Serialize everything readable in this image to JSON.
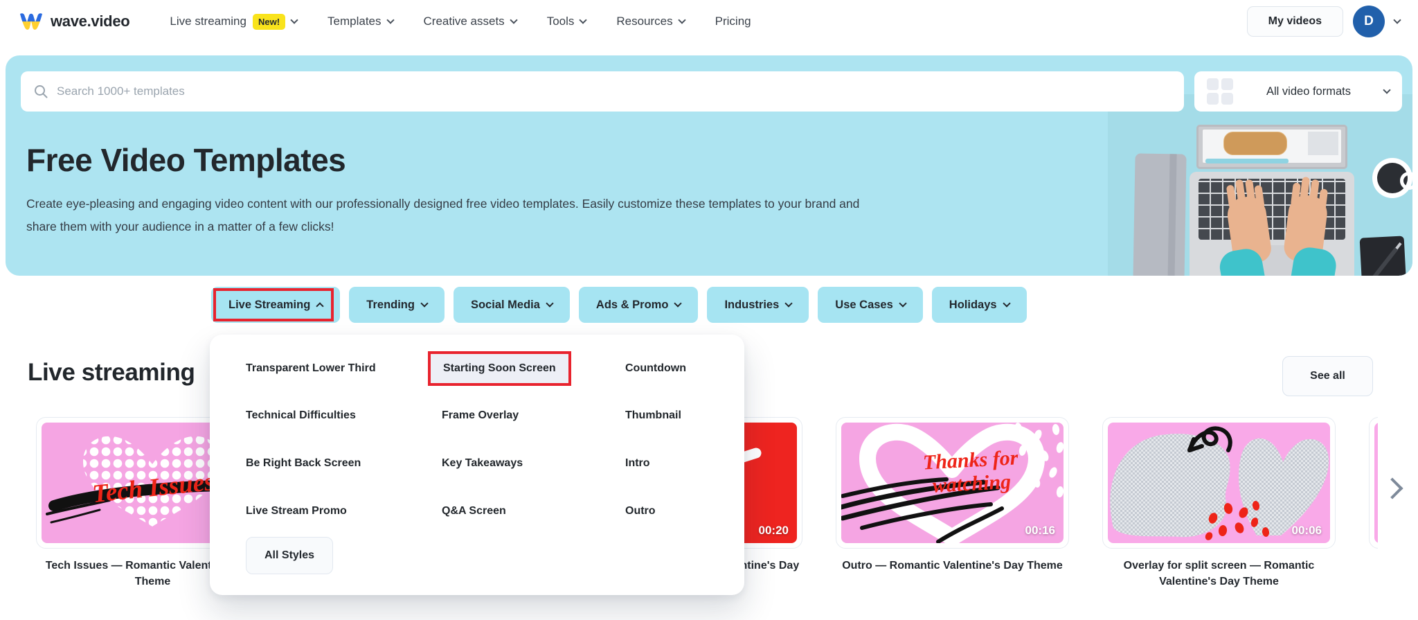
{
  "nav": {
    "brand": "wave.video",
    "items": [
      {
        "label": "Live streaming",
        "badge": "New!"
      },
      {
        "label": "Templates"
      },
      {
        "label": "Creative assets"
      },
      {
        "label": "Tools"
      },
      {
        "label": "Resources"
      },
      {
        "label": "Pricing"
      }
    ],
    "my_videos_label": "My videos",
    "avatar_letter": "D"
  },
  "hero": {
    "search_placeholder": "Search 1000+ templates",
    "format_filter_value": "All video formats",
    "title": "Free Video Templates",
    "description_line1": "Create eye-pleasing and engaging video content with our professionally designed free video templates. Easily customize these templates to your brand and",
    "description_line2": "share them with your audience in a matter of a few clicks!"
  },
  "categories": [
    {
      "label": "Live Streaming",
      "expanded": true,
      "annotated": true
    },
    {
      "label": "Trending"
    },
    {
      "label": "Social Media"
    },
    {
      "label": "Ads & Promo"
    },
    {
      "label": "Industries"
    },
    {
      "label": "Use Cases"
    },
    {
      "label": "Holidays"
    }
  ],
  "dropdown": {
    "items": [
      {
        "label": "Transparent Lower Third"
      },
      {
        "label": "Starting Soon Screen",
        "highlighted": true,
        "annotated": true
      },
      {
        "label": "Countdown"
      },
      {
        "label": "Technical Difficulties"
      },
      {
        "label": "Frame Overlay"
      },
      {
        "label": "Thumbnail"
      },
      {
        "label": "Be Right Back Screen"
      },
      {
        "label": "Key Takeaways"
      },
      {
        "label": "Intro"
      },
      {
        "label": "Live Stream Promo"
      },
      {
        "label": "Q&A Screen"
      },
      {
        "label": "Outro"
      }
    ],
    "all_styles_label": "All Styles"
  },
  "section": {
    "heading": "Live streaming",
    "see_all_label": "See all"
  },
  "cards": [
    {
      "title": "Tech Issues — Romantic Valentine's Day Theme",
      "overlay_text": "Tech Issues",
      "duration": ""
    },
    {
      "title": "",
      "overlay_text": "",
      "duration": ""
    },
    {
      "title": "Be Right Back — Romantic Valentine's Day Theme",
      "overlay_text": "k",
      "duration": "00:20"
    },
    {
      "title": "Outro — Romantic Valentine's Day Theme",
      "overlay_text_line1": "Thanks for",
      "overlay_text_line2": "watching",
      "duration": "00:16"
    },
    {
      "title": "Overlay for split screen — Romantic Valentine's Day Theme",
      "overlay_text": "",
      "duration": "00:06"
    },
    {
      "title": "",
      "overlay_text": "",
      "duration": ""
    }
  ],
  "colors": {
    "annotation_red": "#E8232E",
    "hero_background": "#ADE4F1",
    "category_button": "#A6E4F2",
    "card_pink": "#F5A5E3",
    "card_red": "#EE2420",
    "script_red": "#EE2418",
    "badge_yellow": "#F9E31C",
    "avatar_blue": "#2160AB",
    "brand_blue": "#2B6BE0",
    "brand_yellow": "#FFD02F"
  }
}
